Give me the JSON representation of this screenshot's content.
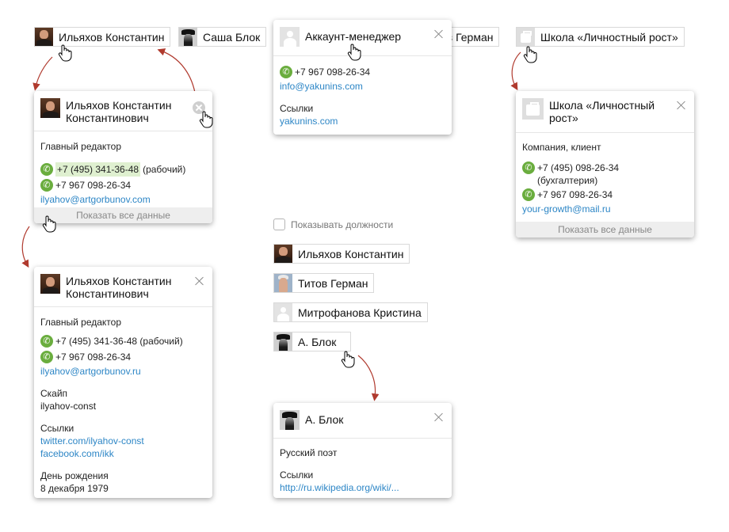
{
  "chips": {
    "ilyahov": "Ильяхов Константин",
    "sasha_blok": "Саша Блок",
    "german": "ов Герман",
    "school": "Школа «Личностный рост»"
  },
  "card_account": {
    "name": "Аккаунт-менеджер",
    "phone": "+7 967 098-26-34",
    "email": "info@yakunins.com",
    "links_label": "Ссылки",
    "link": "yakunins.com"
  },
  "card_ilyahov_small": {
    "name": "Ильяхов Константин Константинович",
    "position": "Главный редактор",
    "phone1": "+7 (495) 341-36-48",
    "phone1_note": "(рабочий)",
    "phone2": "+7 967 098-26-34",
    "email": "ilyahov@artgorbunov.com",
    "show_all": "Показать все данные"
  },
  "card_school": {
    "name": "Школа «Личностный рост»",
    "position": "Компания, клиент",
    "phone1": "+7 (495) 098-26-34",
    "phone1_note": "(бухгалтерия)",
    "phone2": "+7 967 098-26-34",
    "email": "your-growth@mail.ru",
    "show_all": "Показать все данные"
  },
  "checkbox": {
    "label": "Показывать должности",
    "checked": false
  },
  "list": [
    "Ильяхов Константин",
    "Титов Герман",
    "Митрофанова Кристина",
    "А. Блок"
  ],
  "card_ilyahov_full": {
    "name": "Ильяхов Константин Константинович",
    "position": "Главный редактор",
    "phone1": "+7 (495) 341-36-48 (рабочий)",
    "phone2": "+7 967 098-26-34",
    "email": "ilyahov@artgorbunov.ru",
    "skype_label": "Скайп",
    "skype": "ilyahov-const",
    "links_label": "Ссылки",
    "link1": "twitter.com/ilyahov-const",
    "link2": "facebook.com/ikk",
    "birthday_label": "День рождения",
    "birthday": "8 декабря 1979"
  },
  "card_blok": {
    "name": "А. Блок",
    "position": "Русский поэт",
    "links_label": "Ссылки",
    "link": "http://ru.wikipedia.org/wiki/..."
  },
  "colors": {
    "link": "#2d86c6",
    "phone": "#6aad3e",
    "highlight": "#dff0d0",
    "arrow": "#c0392b"
  }
}
